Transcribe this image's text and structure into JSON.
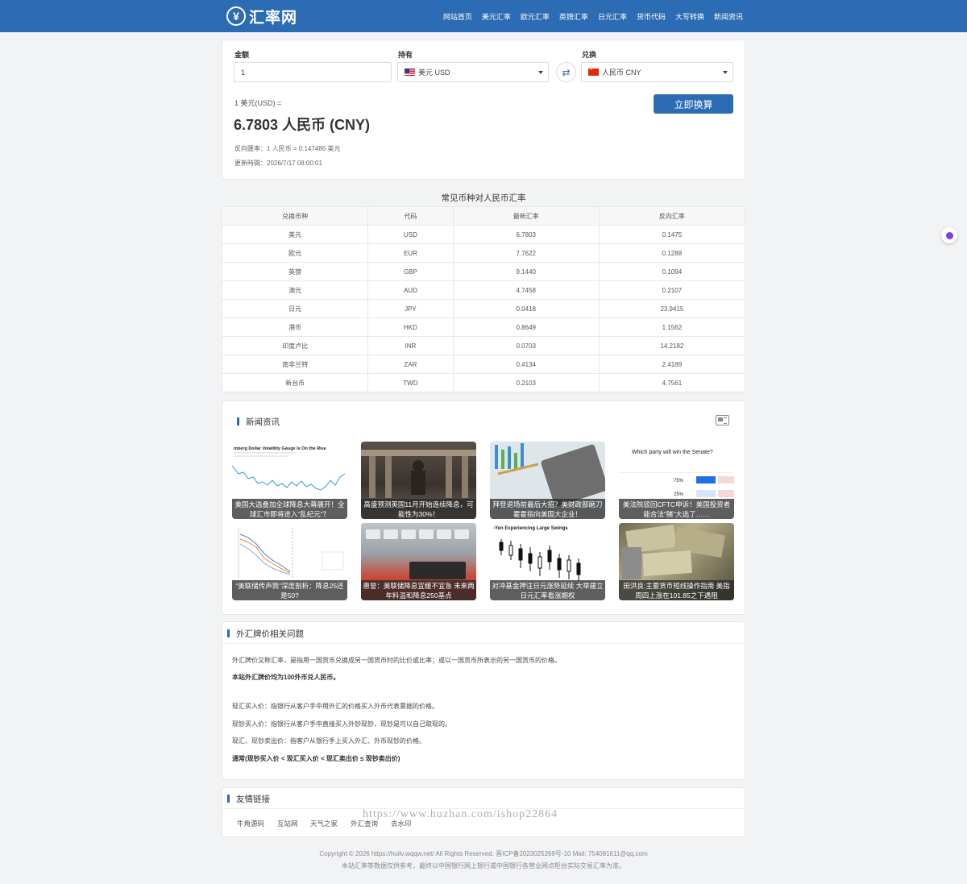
{
  "header": {
    "logo_mark": "¥",
    "logo_text": "汇率网",
    "nav": [
      "网站首页",
      "美元汇率",
      "欧元汇率",
      "英镑汇率",
      "日元汇率",
      "货币代码",
      "大写转换",
      "新闻资讯"
    ]
  },
  "converter": {
    "amount_label": "金额",
    "amount_value": "1",
    "hold_label": "持有",
    "hold_value": "美元 USD",
    "exchange_label": "兑换",
    "exchange_value": "人民币 CNY",
    "swap_icon": "⇄",
    "submit_label": "立即换算",
    "result_prefix": "1 美元(USD) =",
    "result_value": "6.7803 人民币 (CNY)",
    "reverse_rate": "反向匯率：1 人民币 = 0.147486 美元",
    "updated": "更新時間：2026/7/17 08:00:01"
  },
  "rates_table": {
    "title": "常见币种对人民币汇率",
    "headers": [
      "兑换币种",
      "代码",
      "最新汇率",
      "反向汇率"
    ],
    "rows": [
      [
        "美元",
        "USD",
        "6.7803",
        "0.1475"
      ],
      [
        "欧元",
        "EUR",
        "7.7622",
        "0.1288"
      ],
      [
        "英镑",
        "GBP",
        "9.1440",
        "0.1094"
      ],
      [
        "澳元",
        "AUD",
        "4.7458",
        "0.2107"
      ],
      [
        "日元",
        "JPY",
        "0.0418",
        "23.9415"
      ],
      [
        "港币",
        "HKD",
        "0.8649",
        "1.1562"
      ],
      [
        "印度卢比",
        "INR",
        "0.0703",
        "14.2182"
      ],
      [
        "南非兰特",
        "ZAR",
        "0.4134",
        "2.4189"
      ],
      [
        "新台币",
        "TWD",
        "0.2103",
        "4.7561"
      ]
    ]
  },
  "news": {
    "title": "新闻资讯",
    "icon": "newspaper-icon",
    "items": [
      {
        "caption": "美国大选叠加全球降息大幕展开！全球汇市即将进入“乱纪元”？",
        "image_text": "mberg Dollar Volatility Gauge Is On the Rise"
      },
      {
        "caption": "高盛预测英国11月开始连续降息，可能性为30%！",
        "image_text": ""
      },
      {
        "caption": "拜登退场前最后大招？美财政部磨刀霍霍指向美国大企业！",
        "image_text": ""
      },
      {
        "caption": "美法院驳回CFTC申诉！美国投资者能合法“赌”大选了……",
        "image_text": "Which party will win the Senate?"
      },
      {
        "caption": "“美联储传声筒”深度剖析：降息25还是50?",
        "image_text": ""
      },
      {
        "caption": "惠誉：美联储降息宜缓不宜急 未来两年料温和降息250基点",
        "image_text": ""
      },
      {
        "caption": "对冲基金押注日元涨势延续 大举建立日元汇率看涨期权",
        "image_text": "-Yen Experiencing Large Swings"
      },
      {
        "caption": "田洪良:主要货币短线操作指南 美指周四上涨在101.85之下遇阻",
        "image_text": ""
      }
    ]
  },
  "faq": {
    "title": "外汇牌价相关问题",
    "lines": [
      "外汇牌价又称汇率，是指用一国货币兑换成另一国货币时的比价或比率；或以一国货币所表示的另一国货币的价格。",
      "本站外汇牌价均为100外币兑人民币。",
      "现汇买入价：指银行从客户手中用外汇的价格买入外币代表票据的价格。",
      "现钞买入价：指银行从客户手中直接买入外钞现钞，现钞是可以自己取现的。",
      "现汇、现钞卖出价：指客户从银行手上买入外汇、外币现钞的价格。",
      "通常(现钞买入价 < 现汇买入价 < 现汇卖出价 ≤ 现钞卖出价)"
    ]
  },
  "links": {
    "title": "友情链接",
    "items": [
      "牛角源码",
      "互站网",
      "天气之家",
      "外汇查询",
      "去水印"
    ]
  },
  "footer": {
    "line1": "Copyright © 2026 https://huilv.wqqw.net/ All Rights Reserved.  晋ICP备2023025269号-10  Mail: 754081611@qq.com",
    "line2": "本站汇率等数据仅供参考，最终以中国银行网上银行或中国银行各营业网点柜台实际交易汇率为准。"
  },
  "watermark": "https://www.huzhan.com/ishop22864",
  "colors": {
    "brand": "#2b6cb5",
    "floating_badge": "#7b3fe4"
  }
}
